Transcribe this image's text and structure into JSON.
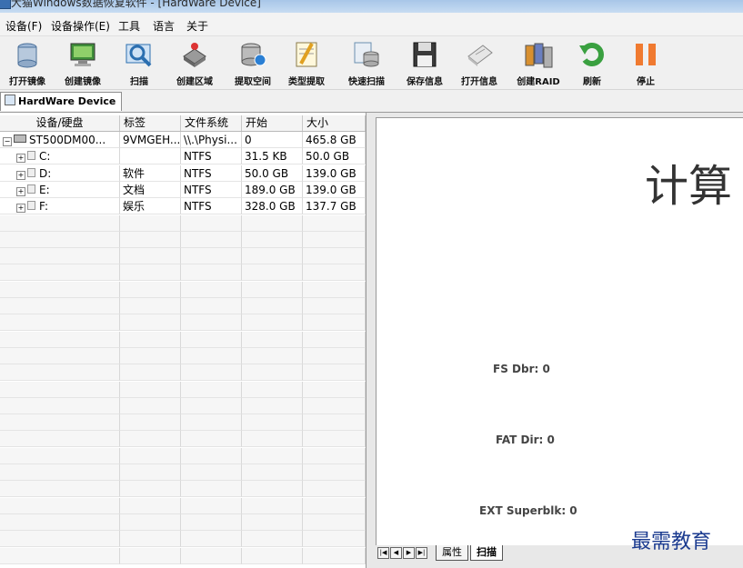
{
  "window": {
    "title": "大猫Windows数据恢复软件 - [HardWare Device]"
  },
  "menubar": {
    "items": [
      "设备(F)",
      "设备操作(E)",
      "工具",
      "语言",
      "关于"
    ]
  },
  "toolbar": {
    "buttons": [
      {
        "label": "打开镜像",
        "icon": "open-image-icon",
        "color": "#4a7fb8"
      },
      {
        "label": "创建镜像",
        "icon": "create-image-icon",
        "color": "#5c9a3a"
      },
      {
        "label": "扫描",
        "icon": "scan-icon",
        "color": "#2c6fb0"
      },
      {
        "label": "创建区域",
        "icon": "create-region-icon",
        "color": "#777777"
      },
      {
        "label": "提取空间",
        "icon": "extract-space-icon",
        "color": "#2a7fd4"
      },
      {
        "label": "类型提取",
        "icon": "type-extract-icon",
        "color": "#e0a020"
      },
      {
        "label": "快速扫描",
        "icon": "quick-scan-icon",
        "color": "#6a8fb0"
      },
      {
        "label": "保存信息",
        "icon": "save-info-icon",
        "color": "#444444"
      },
      {
        "label": "打开信息",
        "icon": "open-info-icon",
        "color": "#999999"
      },
      {
        "label": "创建RAID",
        "icon": "create-raid-icon",
        "color": "#d89030"
      },
      {
        "label": "刷新",
        "icon": "refresh-icon",
        "color": "#3aa040"
      },
      {
        "label": "停止",
        "icon": "stop-icon",
        "color": "#f07a30"
      }
    ]
  },
  "tab": {
    "label": "HardWare Device"
  },
  "grid": {
    "columns": [
      "设备/硬盘",
      "标签",
      "文件系统",
      "开始",
      "大小"
    ],
    "rows": [
      {
        "expander": "⊟",
        "type": "disk",
        "name": "ST500DM00...",
        "label": "9VMGEH...",
        "fs": "\\\\.\\Physi...",
        "start": "0",
        "size": "465.8 GB"
      },
      {
        "expander": "⊞",
        "type": "partition",
        "name": "C:",
        "label": "",
        "fs": "NTFS",
        "start": "31.5 KB",
        "size": "50.0 GB"
      },
      {
        "expander": "⊞",
        "type": "partition",
        "name": "D:",
        "label": "软件",
        "fs": "NTFS",
        "start": "50.0 GB",
        "size": "139.0 GB"
      },
      {
        "expander": "⊞",
        "type": "partition",
        "name": "E:",
        "label": "文档",
        "fs": "NTFS",
        "start": "189.0 GB",
        "size": "139.0 GB"
      },
      {
        "expander": "⊞",
        "type": "partition",
        "name": "F:",
        "label": "娱乐",
        "fs": "NTFS",
        "start": "328.0 GB",
        "size": "137.7 GB"
      }
    ]
  },
  "scan_view": {
    "title": "计算",
    "fs_line": "FS    Dbr: 0",
    "fat_line": "FAT  Dir: 0",
    "ext_line": "EXT Superblk: 0",
    "tabs": [
      "属性",
      "扫描"
    ]
  },
  "watermark": "最需教育"
}
